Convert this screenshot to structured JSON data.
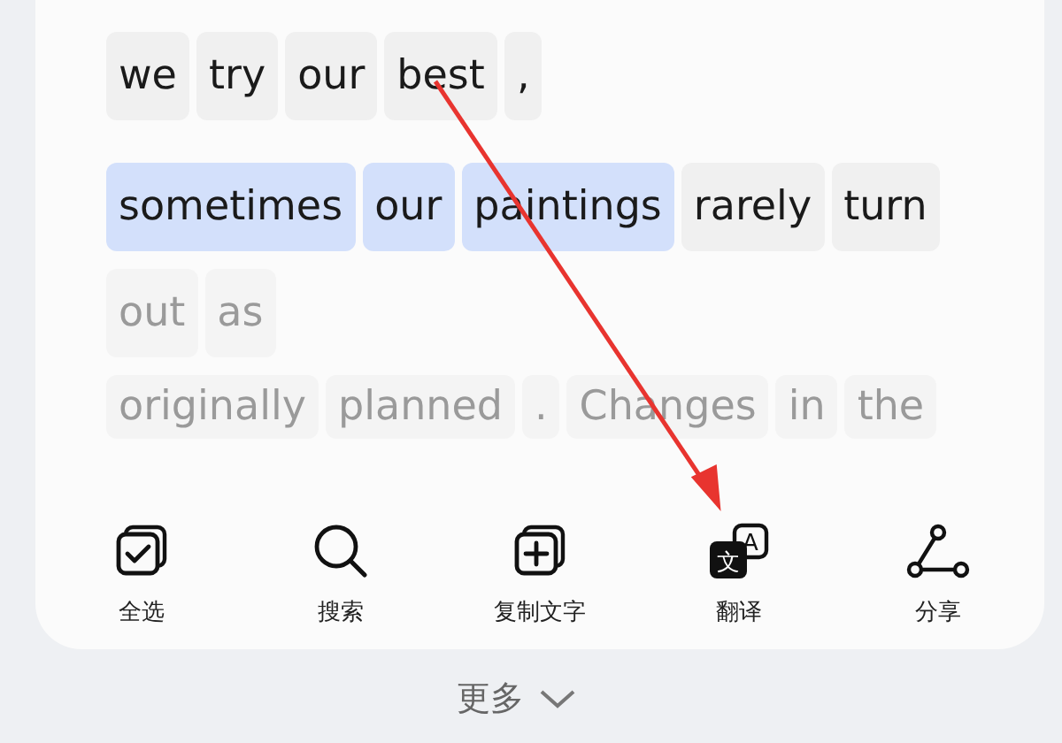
{
  "text_rows": [
    [
      {
        "text": "we",
        "selected": false,
        "faded": false
      },
      {
        "text": "try",
        "selected": false,
        "faded": false
      },
      {
        "text": "our",
        "selected": false,
        "faded": false
      },
      {
        "text": "best",
        "selected": false,
        "faded": false
      },
      {
        "text": ",",
        "selected": false,
        "faded": false
      }
    ],
    [
      {
        "text": "sometimes",
        "selected": true,
        "faded": false
      },
      {
        "text": "our",
        "selected": true,
        "faded": false
      },
      {
        "text": "paintings",
        "selected": true,
        "faded": false
      },
      {
        "text": "rarely",
        "selected": false,
        "faded": false
      },
      {
        "text": "turn",
        "selected": false,
        "faded": false
      }
    ],
    [
      {
        "text": "out",
        "selected": false,
        "faded": true
      },
      {
        "text": "as",
        "selected": false,
        "faded": true
      }
    ],
    [
      {
        "text": "originally",
        "selected": false,
        "faded": true
      },
      {
        "text": "planned",
        "selected": false,
        "faded": true
      },
      {
        "text": ".",
        "selected": false,
        "faded": true
      },
      {
        "text": "Changes",
        "selected": false,
        "faded": true
      },
      {
        "text": "in",
        "selected": false,
        "faded": true
      },
      {
        "text": "the",
        "selected": false,
        "faded": true
      }
    ]
  ],
  "toolbar": [
    {
      "kind": "select_all",
      "label": "全选"
    },
    {
      "kind": "search",
      "label": "搜索"
    },
    {
      "kind": "copy_text",
      "label": "复制文字"
    },
    {
      "kind": "translate",
      "label": "翻译",
      "icon_front": "文",
      "icon_back": "A"
    },
    {
      "kind": "share",
      "label": "分享"
    }
  ],
  "more_button": {
    "label": "更多"
  }
}
